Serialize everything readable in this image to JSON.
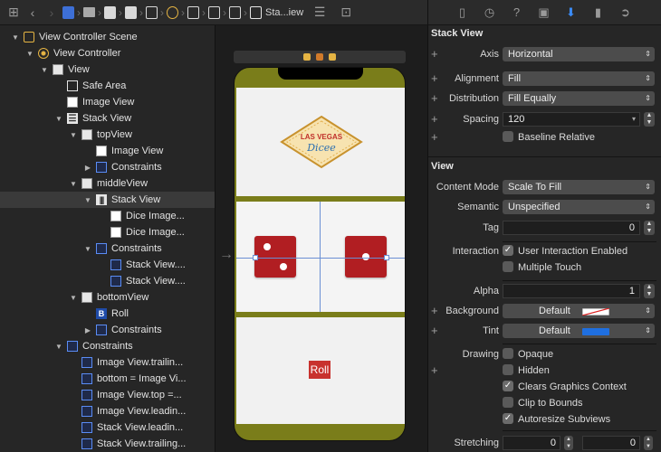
{
  "jumpbar": {
    "crumb_last": "Sta...iew"
  },
  "outline": {
    "rows": [
      {
        "label": "View Controller Scene",
        "disc": "▼",
        "icon": "scene"
      },
      {
        "label": "View Controller",
        "disc": "▼",
        "icon": "vc"
      },
      {
        "label": "View",
        "disc": "▼",
        "icon": "view"
      },
      {
        "label": "Safe Area",
        "disc": "",
        "icon": "safe"
      },
      {
        "label": "Image View",
        "disc": "",
        "icon": "img"
      },
      {
        "label": "Stack View",
        "disc": "▼",
        "icon": "stack"
      },
      {
        "label": "topView",
        "disc": "▼",
        "icon": "view"
      },
      {
        "label": "Image View",
        "disc": "",
        "icon": "img"
      },
      {
        "label": "Constraints",
        "disc": "▶",
        "icon": "cons"
      },
      {
        "label": "middleView",
        "disc": "▼",
        "icon": "view"
      },
      {
        "label": "Stack View",
        "disc": "▼",
        "icon": "hstack"
      },
      {
        "label": "Dice Image...",
        "disc": "",
        "icon": "img"
      },
      {
        "label": "Dice Image...",
        "disc": "",
        "icon": "img"
      },
      {
        "label": "Constraints",
        "disc": "▼",
        "icon": "cons"
      },
      {
        "label": "Stack View....",
        "disc": "",
        "icon": "cons"
      },
      {
        "label": "Stack View....",
        "disc": "",
        "icon": "cons"
      },
      {
        "label": "bottomView",
        "disc": "▼",
        "icon": "view"
      },
      {
        "label": "Roll",
        "disc": "",
        "icon": "btn"
      },
      {
        "label": "Constraints",
        "disc": "▶",
        "icon": "cons"
      },
      {
        "label": "Constraints",
        "disc": "▼",
        "icon": "cons"
      },
      {
        "label": "Image View.trailin...",
        "disc": "",
        "icon": "cons"
      },
      {
        "label": "bottom = Image Vi...",
        "disc": "",
        "icon": "cons"
      },
      {
        "label": "Image View.top =...",
        "disc": "",
        "icon": "cons"
      },
      {
        "label": "Image View.leadin...",
        "disc": "",
        "icon": "cons"
      },
      {
        "label": "Stack View.leadin...",
        "disc": "",
        "icon": "cons"
      },
      {
        "label": "Stack View.trailing...",
        "disc": "",
        "icon": "cons"
      }
    ],
    "selected_index": 10
  },
  "canvas": {
    "logo_line1": "LAS VEGAS",
    "logo_line2": "Dicee",
    "roll_label": "Roll",
    "colors": {
      "phone_bg": "#7a7d1a",
      "die": "#b11e22",
      "roll": "#c8322e"
    }
  },
  "inspector": {
    "stack_header": "Stack View",
    "axis_label": "Axis",
    "axis_value": "Horizontal",
    "alignment_label": "Alignment",
    "alignment_value": "Fill",
    "distribution_label": "Distribution",
    "distribution_value": "Fill Equally",
    "spacing_label": "Spacing",
    "spacing_value": "120",
    "baseline_label": "Baseline Relative",
    "view_header": "View",
    "content_mode_label": "Content Mode",
    "content_mode_value": "Scale To Fill",
    "semantic_label": "Semantic",
    "semantic_value": "Unspecified",
    "tag_label": "Tag",
    "tag_value": "0",
    "interaction_label": "Interaction",
    "user_interaction_label": "User Interaction Enabled",
    "multiple_touch_label": "Multiple Touch",
    "alpha_label": "Alpha",
    "alpha_value": "1",
    "background_label": "Background",
    "background_value": "Default",
    "tint_label": "Tint",
    "tint_value": "Default",
    "drawing_label": "Drawing",
    "opaque_label": "Opaque",
    "hidden_label": "Hidden",
    "clears_label": "Clears Graphics Context",
    "clip_label": "Clip to Bounds",
    "autoresize_label": "Autoresize Subviews",
    "stretching_label": "Stretching",
    "stretch_x": "0",
    "stretch_y": "0",
    "checks": {
      "user_interaction": true,
      "multiple_touch": false,
      "opaque": false,
      "hidden": false,
      "clears": true,
      "clip": false,
      "autoresize": true,
      "baseline": false
    },
    "tint_color": "#1f6fe0"
  }
}
